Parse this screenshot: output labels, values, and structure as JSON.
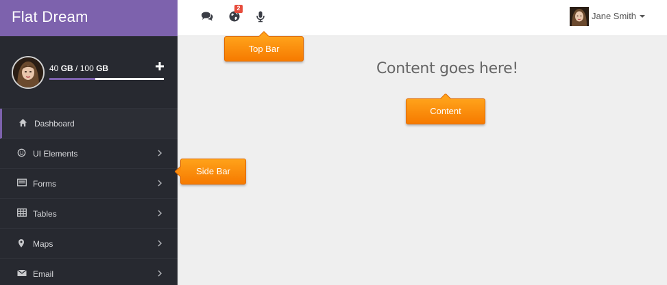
{
  "app": {
    "brand": "Flat Dream"
  },
  "profile": {
    "storage_used": "40",
    "storage_used_unit": "GB",
    "storage_sep": " / ",
    "storage_total": "100",
    "storage_total_unit": "GB",
    "storage_fraction": 0.4,
    "add_icon": "plus-icon"
  },
  "sidebar": {
    "items": [
      {
        "label": "Dashboard",
        "icon": "home-icon",
        "active": true,
        "has_submenu": false
      },
      {
        "label": "UI Elements",
        "icon": "smiley-icon",
        "active": false,
        "has_submenu": true
      },
      {
        "label": "Forms",
        "icon": "form-icon",
        "active": false,
        "has_submenu": true
      },
      {
        "label": "Tables",
        "icon": "table-icon",
        "active": false,
        "has_submenu": true
      },
      {
        "label": "Maps",
        "icon": "map-marker-icon",
        "active": false,
        "has_submenu": true
      },
      {
        "label": "Email",
        "icon": "envelope-icon",
        "active": false,
        "has_submenu": true
      }
    ]
  },
  "topbar": {
    "icons": [
      "comments-icon",
      "globe-icon",
      "microphone-icon"
    ],
    "notification_count": "2",
    "user_name": "Jane Smith"
  },
  "content": {
    "placeholder": "Content goes here!"
  },
  "callouts": {
    "top_bar": "Top Bar",
    "content": "Content",
    "side_bar": "Side Bar"
  },
  "colors": {
    "brand": "#7d62ad",
    "sidebar_bg": "#272930",
    "callout": "#f67a00",
    "badge": "#e74c3c"
  }
}
